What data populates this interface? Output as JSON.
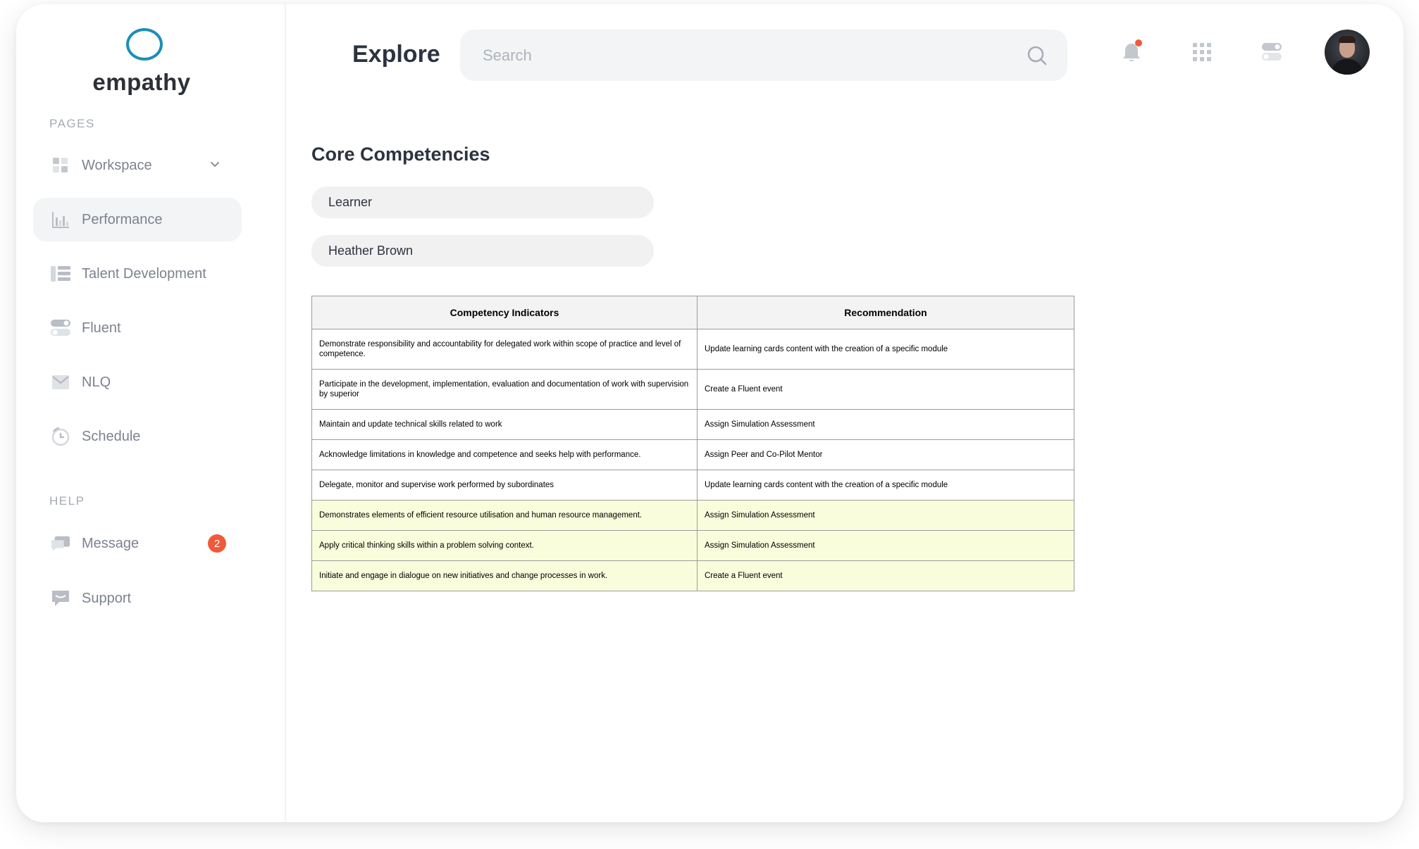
{
  "app": {
    "brand": "empathy"
  },
  "sidebar": {
    "pages_label": "PAGES",
    "help_label": "HELP",
    "items": [
      {
        "label": "Workspace",
        "icon": "grid-icon"
      },
      {
        "label": "Performance",
        "icon": "bar-chart-icon"
      },
      {
        "label": "Talent Development",
        "icon": "list-icon"
      },
      {
        "label": "Fluent",
        "icon": "toggle-icon"
      },
      {
        "label": "NLQ",
        "icon": "mail-icon"
      },
      {
        "label": "Schedule",
        "icon": "clock-icon"
      }
    ],
    "help_items": [
      {
        "label": "Message",
        "icon": "chat-icon",
        "badge": "2"
      },
      {
        "label": "Support",
        "icon": "support-icon"
      }
    ]
  },
  "header": {
    "title": "Explore",
    "search_placeholder": "Search"
  },
  "main": {
    "section_title": "Core Competencies",
    "filters": [
      "Learner",
      "Heather Brown"
    ],
    "table": {
      "headers": [
        "Competency Indicators",
        "Recommendation"
      ],
      "rows": [
        {
          "indicator": "Demonstrate responsibility and accountability for delegated work within scope of practice and level of competence.",
          "recommendation": "Update learning cards content with the creation of a specific module"
        },
        {
          "indicator": "Participate in the development, implementation,  evaluation and documentation of work with supervision by superior",
          "recommendation": "Create a Fluent event"
        },
        {
          "indicator": "Maintain and update technical skills related to work",
          "recommendation": "Assign Simulation Assessment"
        },
        {
          "indicator": "Acknowledge limitations in knowledge and competence and seeks help with performance.",
          "recommendation": "Assign Peer and Co-Pilot Mentor"
        },
        {
          "indicator": "Delegate, monitor and supervise work performed by subordinates",
          "recommendation": "Update learning cards content with the creation of a specific module"
        },
        {
          "indicator": "Demonstrates elements of efficient resource utilisation and human resource management.",
          "recommendation": "Assign Simulation Assessment"
        },
        {
          "indicator": "Apply critical thinking skills within a problem solving context.",
          "recommendation": "Assign Simulation Assessment"
        },
        {
          "indicator": "Initiate and engage in dialogue on new initiatives and change processes in work.",
          "recommendation": "Create a Fluent event"
        }
      ]
    }
  },
  "colors": {
    "accent": "#1b8fb8",
    "badge": "#f05a3a",
    "highlight_row": "#f9fddb"
  }
}
